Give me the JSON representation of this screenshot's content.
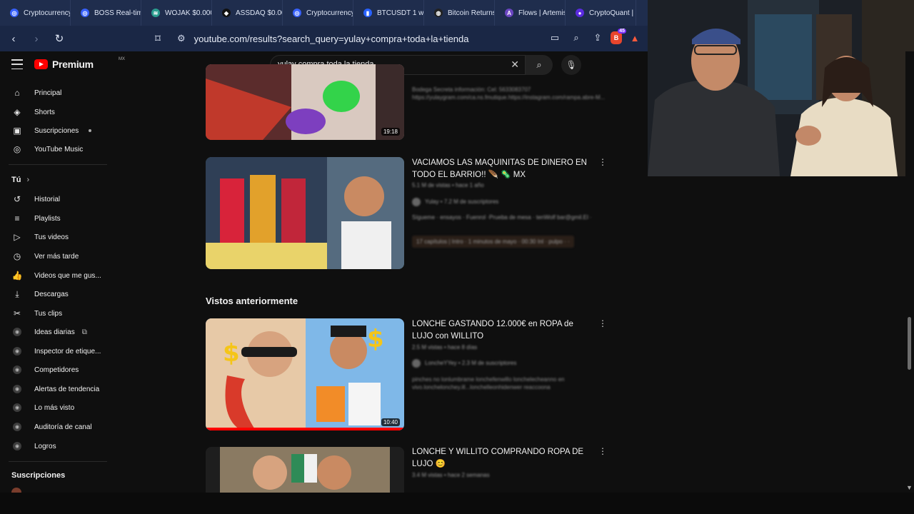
{
  "tabs": [
    {
      "label": "Cryptocurrency",
      "icon": "coinmarketcap-icon",
      "color": "#3861fb",
      "glyph": "◎"
    },
    {
      "label": "BOSS Real-time",
      "icon": "coinmarketcap-icon",
      "color": "#3861fb",
      "glyph": "◎"
    },
    {
      "label": "WOJAK $0.000",
      "icon": "dex-icon",
      "color": "#2a9d8f",
      "glyph": "≋"
    },
    {
      "label": "ASSDAQ $0.00",
      "icon": "dexscreener-icon",
      "color": "#111111",
      "glyph": "◆"
    },
    {
      "label": "Cryptocurrency",
      "icon": "coinmarketcap-icon",
      "color": "#3861fb",
      "glyph": "◎"
    },
    {
      "label": "BTCUSDT 1 we",
      "icon": "tradingview-icon",
      "color": "#2962ff",
      "glyph": "▮"
    },
    {
      "label": "Bitcoin Returns",
      "icon": "coinglass-icon",
      "color": "#222222",
      "glyph": "◍"
    },
    {
      "label": "Flows | Artemis",
      "icon": "artemis-icon",
      "color": "#6b46c1",
      "glyph": "A"
    },
    {
      "label": "CryptoQuant | C",
      "icon": "cryptoquant-icon",
      "color": "#5b2be0",
      "glyph": "●"
    }
  ],
  "browser": {
    "url": "youtube.com/results?search_query=yulay+compra+toda+la+tienda",
    "brave_badge": "45"
  },
  "youtube": {
    "logo_text": "Premium",
    "country": "MX",
    "search_query": "yulay compra toda la tienda"
  },
  "sidebar": {
    "main": [
      {
        "label": "Principal",
        "icon": "home-icon",
        "glyph": "⌂"
      },
      {
        "label": "Shorts",
        "icon": "shorts-icon",
        "glyph": "◈"
      },
      {
        "label": "Suscripciones",
        "icon": "subscriptions-icon",
        "glyph": "▣"
      },
      {
        "label": "YouTube Music",
        "icon": "youtube-music-icon",
        "glyph": "◎"
      }
    ],
    "you_header": "Tú",
    "you": [
      {
        "label": "Historial",
        "icon": "history-icon",
        "glyph": "↺"
      },
      {
        "label": "Playlists",
        "icon": "playlists-icon",
        "glyph": "≡"
      },
      {
        "label": "Tus videos",
        "icon": "your-videos-icon",
        "glyph": "▷"
      },
      {
        "label": "Ver más tarde",
        "icon": "watch-later-icon",
        "glyph": "◷"
      },
      {
        "label": "Videos que me gus...",
        "icon": "liked-icon",
        "glyph": "👍"
      },
      {
        "label": "Descargas",
        "icon": "downloads-icon",
        "glyph": "⤓"
      },
      {
        "label": "Tus clips",
        "icon": "clips-icon",
        "glyph": "✂"
      }
    ],
    "extensions": [
      {
        "label": "Ideas diarias",
        "external": true
      },
      {
        "label": "Inspector de etique..."
      },
      {
        "label": "Competidores"
      },
      {
        "label": "Alertas de tendencia"
      },
      {
        "label": "Lo más visto"
      },
      {
        "label": "Auditoría de canal"
      },
      {
        "label": "Logros"
      }
    ],
    "subscriptions_header": "Suscripciones"
  },
  "results": {
    "video1": {
      "duration": "19:18",
      "desc_line1": "Bodega Secreta información: Cel: 5633083707",
      "desc_line2": "https://yulaygram.com/ca.ns.fmutique.https://instagram.com/rampa.abre-M..."
    },
    "video2": {
      "title": "VACIAMOS LAS MAQUINITAS DE DINERO EN TODO EL BARRIO!! 🪶 🦠 MX",
      "meta": "5.1 M de vistas • hace 1 año",
      "channel": "Yulay • 7.2 M de suscriptores",
      "desc": "Sígueme · ensayos · Fuenrol ·Prueba de mesa · tenWolf bar@gmil.El ·",
      "chapters": "17 capítulos | Intro · 1 minutos de mayo · 00:30 Inl · pulpo · ·"
    },
    "seen_header": "Vistos anteriormente",
    "video3": {
      "title": "LONCHE GASTANDO 12.000€ en ROPA de LUJO con WILLITO",
      "meta": "2.5 M vistas • hace 8 días",
      "channel": "LoncheYYey • 2.3 M de suscriptores",
      "desc_line1": "pinches no lonlumbrame lonchefenwillo lonchelecheanno en",
      "desc_line2": "vivo.lonchelonchey.ill...lonchelleonhidenwer reaccoona",
      "duration": "10:40"
    },
    "video4": {
      "title": "LONCHE Y WILLITO COMPRANDO ROPA DE LUJO 😊",
      "meta": "3.4 M vistas • hace 2 semanas"
    }
  }
}
